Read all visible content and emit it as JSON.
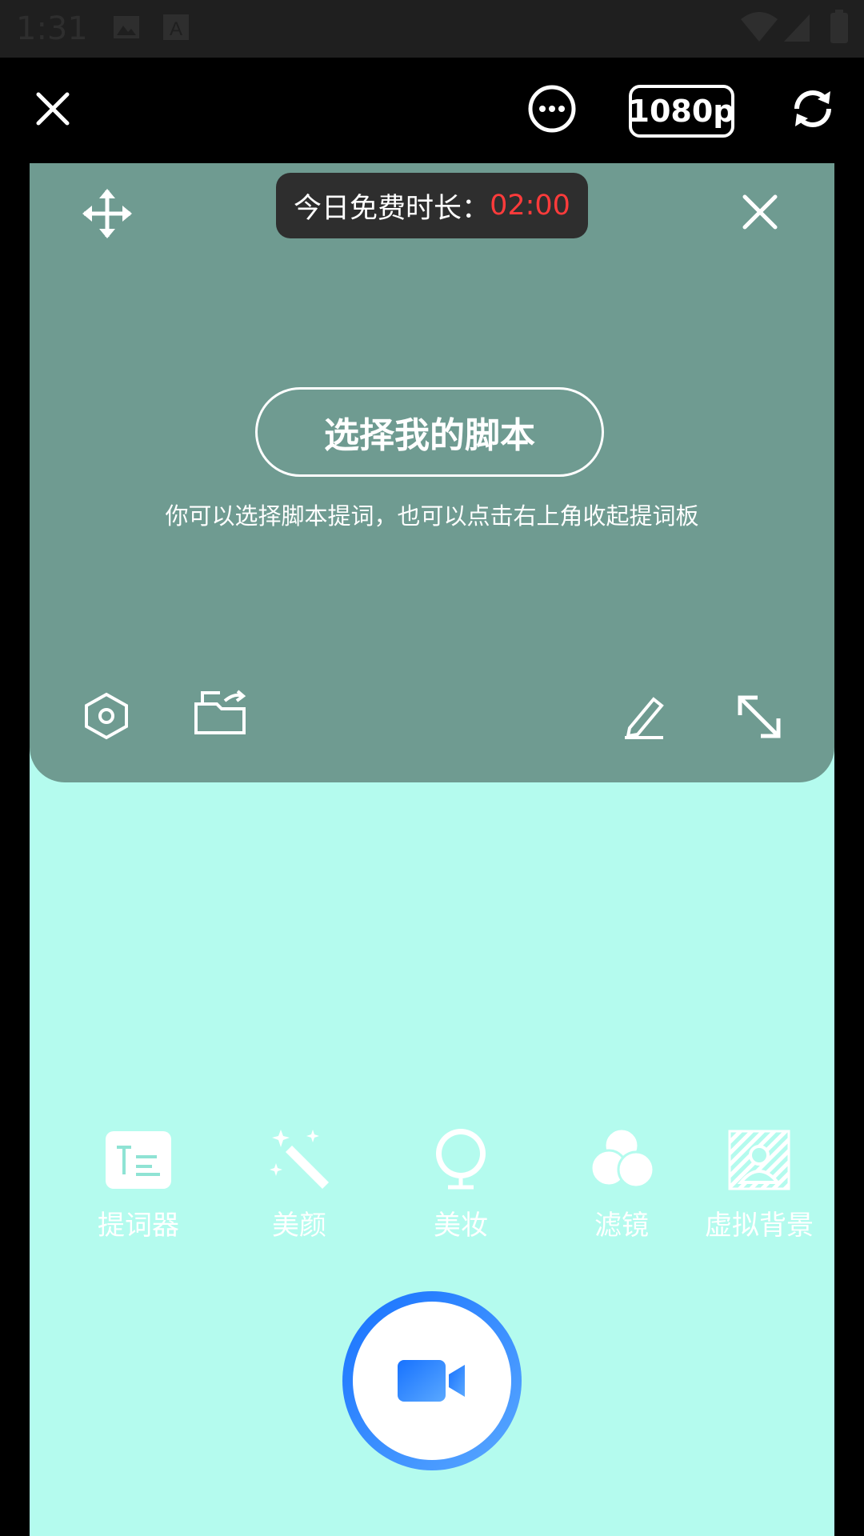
{
  "status_bar": {
    "time": "1:31"
  },
  "top_bar": {
    "resolution": "1080p"
  },
  "prompter": {
    "timer_label": "今日免费时长：",
    "timer_value": "02:00",
    "select_script_button": "选择我的脚本",
    "hint": "你可以选择脚本提词，也可以点击右上角收起提词板"
  },
  "tools": [
    {
      "label": "提词器",
      "icon": "teleprompter-icon"
    },
    {
      "label": "美颜",
      "icon": "beauty-wand-icon"
    },
    {
      "label": "美妆",
      "icon": "makeup-mirror-icon"
    },
    {
      "label": "滤镜",
      "icon": "filter-circles-icon"
    },
    {
      "label": "虚拟背景",
      "icon": "virtual-background-icon"
    }
  ],
  "colors": {
    "prompter_bg": "#6f9b91",
    "stage_bg": "#b4fbee",
    "timer_value": "#ff3b3b",
    "record_gradient_start": "#1772ff",
    "record_gradient_end": "#5aa8ff"
  }
}
